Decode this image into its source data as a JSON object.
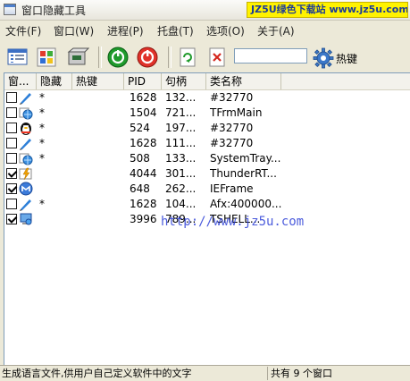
{
  "window": {
    "title": "窗口隐藏工具",
    "banner_text": "JZ5U绿色下载站 www.jz5u.com"
  },
  "menu": [
    "文件(F)",
    "窗口(W)",
    "进程(P)",
    "托盘(T)",
    "选项(O)",
    "关于(A)"
  ],
  "toolbar": {
    "search_value": "",
    "hotkey_label": "热键"
  },
  "columns": [
    "窗...",
    "隐藏",
    "热键",
    "PID",
    "句柄",
    "类名称"
  ],
  "rows": [
    {
      "checked": false,
      "icon": "pen-app-icon",
      "hidden": "*",
      "hotkey": "",
      "pid": "1628",
      "handle": "132...",
      "class": "#32770"
    },
    {
      "checked": false,
      "icon": "globe-app-icon",
      "hidden": "*",
      "hotkey": "",
      "pid": "1504",
      "handle": "721...",
      "class": "TFrmMain"
    },
    {
      "checked": false,
      "icon": "qq-penguin-icon",
      "hidden": "*",
      "hotkey": "",
      "pid": "524",
      "handle": "197...",
      "class": "#32770"
    },
    {
      "checked": false,
      "icon": "pen-app-icon",
      "hidden": "*",
      "hotkey": "",
      "pid": "1628",
      "handle": "111...",
      "class": "#32770"
    },
    {
      "checked": false,
      "icon": "globe-app-icon",
      "hidden": "*",
      "hotkey": "",
      "pid": "508",
      "handle": "133...",
      "class": "SystemTray..."
    },
    {
      "checked": true,
      "icon": "thunder-app-icon",
      "hidden": "",
      "hotkey": "",
      "pid": "4044",
      "handle": "301...",
      "class": "ThunderRT..."
    },
    {
      "checked": true,
      "icon": "maxthon-icon",
      "hidden": "",
      "hotkey": "",
      "pid": "648",
      "handle": "262...",
      "class": "IEFrame"
    },
    {
      "checked": false,
      "icon": "pen-app-icon",
      "hidden": "*",
      "hotkey": "",
      "pid": "1628",
      "handle": "104...",
      "class": "Afx:400000..."
    },
    {
      "checked": true,
      "icon": "computer-icon",
      "hidden": "",
      "hotkey": "",
      "pid": "3996",
      "handle": "789...",
      "class": "TSHELL..."
    }
  ],
  "overlay_watermark": "http://www.jz5u.com",
  "status": {
    "left": "生成语言文件,供用户自己定义软件中的文字",
    "right": "共有 9 个窗口"
  }
}
